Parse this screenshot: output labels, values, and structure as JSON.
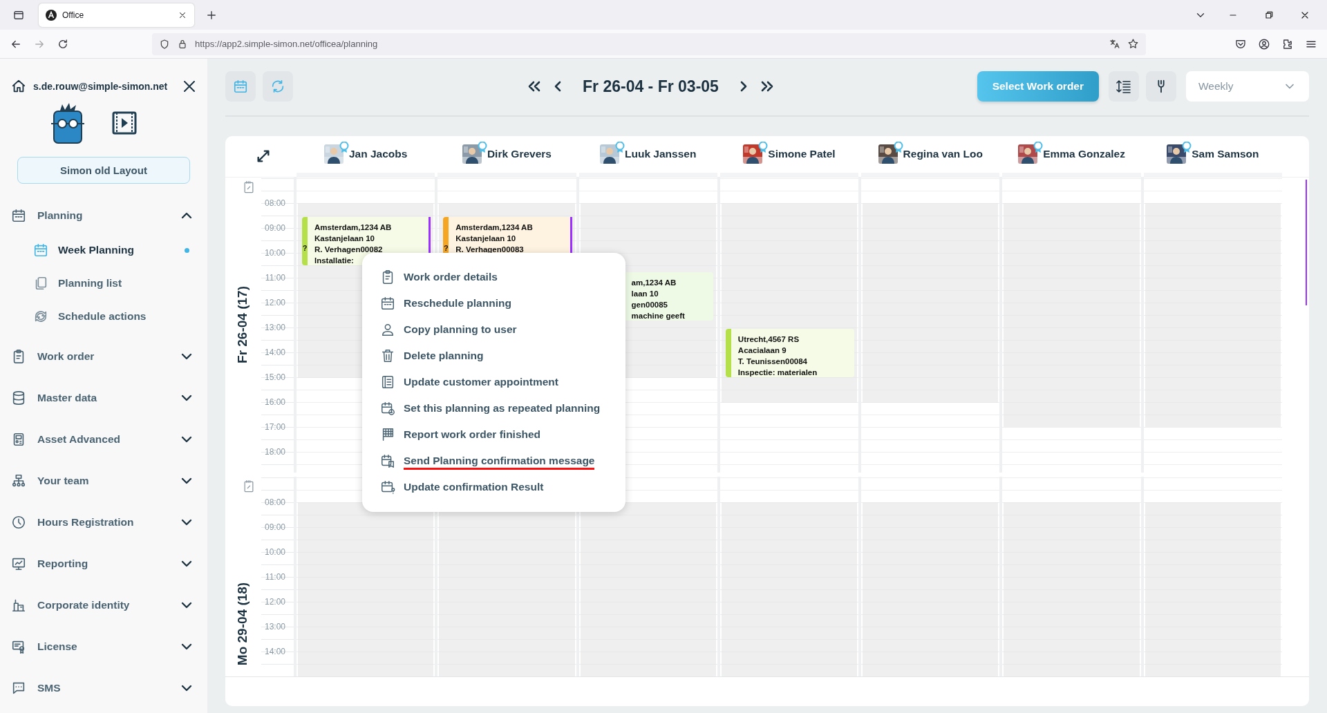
{
  "browser": {
    "tab_title": "Office",
    "url": "https://app2.simple-simon.net/officea/planning"
  },
  "sidebar": {
    "user_email": "s.de.rouw@simple-simon.net",
    "layout_button": "Simon old Layout",
    "items": [
      {
        "label": "Planning",
        "expanded": true,
        "children": [
          {
            "label": "Week Planning",
            "selected": true
          },
          {
            "label": "Planning list",
            "selected": false
          },
          {
            "label": "Schedule actions",
            "selected": false
          }
        ]
      },
      {
        "label": "Work order",
        "expanded": false
      },
      {
        "label": "Master data",
        "expanded": false
      },
      {
        "label": "Asset Advanced",
        "expanded": false
      },
      {
        "label": "Your team",
        "expanded": false
      },
      {
        "label": "Hours Registration",
        "expanded": false
      },
      {
        "label": "Reporting",
        "expanded": false
      },
      {
        "label": "Corporate identity",
        "expanded": false
      },
      {
        "label": "License",
        "expanded": false
      },
      {
        "label": "SMS",
        "expanded": false
      }
    ]
  },
  "toolbar": {
    "date_range": "Fr 26-04 - Fr 03-05",
    "primary_button": "Select Work order",
    "view_select": "Weekly"
  },
  "staff": [
    {
      "name": "Jan Jacobs"
    },
    {
      "name": "Dirk Grevers"
    },
    {
      "name": "Luuk Janssen"
    },
    {
      "name": "Simone Patel"
    },
    {
      "name": "Regina van Loo"
    },
    {
      "name": "Emma Gonzalez"
    },
    {
      "name": "Sam Samson"
    }
  ],
  "days": [
    {
      "label": "Fr 26-04 (17)",
      "hours": [
        "08:00",
        "09:00",
        "10:00",
        "11:00",
        "12:00",
        "13:00",
        "14:00",
        "15:00",
        "16:00",
        "17:00",
        "18:00"
      ],
      "columns": [
        {
          "shading": {
            "level": 0.65
          },
          "events": [
            {
              "kind": "morning",
              "color": "#b5e04a",
              "flagged": true,
              "marker": "?",
              "lines": [
                "Amsterdam,1234 AB",
                "Kastanjelaan 10",
                "R. Verhagen00082",
                "Installatie:"
              ]
            }
          ]
        },
        {
          "shading": {
            "level": 0.65
          },
          "events": [
            {
              "kind": "morning",
              "color": "#f5a623",
              "flagged": true,
              "marker": "?",
              "lines": [
                "Amsterdam,1234 AB",
                "Kastanjelaan 10",
                "R. Verhagen00083"
              ]
            }
          ]
        },
        {
          "shading": {
            "level": 0.65
          },
          "events": [
            {
              "kind": "forenoon",
              "flagged": false,
              "lines": [
                "am,1234 AB",
                "laan 10",
                "gen00085",
                "machine geeft"
              ]
            }
          ]
        },
        {
          "shading": {
            "level": 0.74
          },
          "events": [
            {
              "kind": "afternoon",
              "color": "#b5e04a",
              "flagged": false,
              "lines": [
                "Utrecht,4567 RS",
                "Acacialaan 9",
                "T. Teunissen00084",
                "Inspectie: materialen"
              ]
            }
          ]
        },
        {
          "shading": {
            "level": 0.74
          }
        },
        {
          "shading": {
            "level": 0.83
          }
        },
        {
          "shading": {
            "level": 0.83
          }
        }
      ]
    },
    {
      "label": "Mo 29-04 (18)",
      "hours": [
        "08:00",
        "09:00",
        "10:00",
        "11:00",
        "12:00",
        "13:00",
        "14:00"
      ],
      "columns": [
        {
          "shading": {
            "level": 1
          }
        },
        {
          "shading": {
            "level": 1
          }
        },
        {
          "shading": {
            "level": 1
          }
        },
        {
          "shading": {
            "level": 1
          }
        },
        {
          "shading": {
            "level": 1
          }
        },
        {
          "shading": {
            "level": 1
          }
        },
        {
          "shading": {
            "level": 1
          }
        }
      ]
    }
  ],
  "context_menu": {
    "items": [
      {
        "label": "Work order details",
        "underlined": false
      },
      {
        "label": "Reschedule planning",
        "underlined": false
      },
      {
        "label": "Copy planning to user",
        "underlined": false
      },
      {
        "label": "Delete planning",
        "underlined": false
      },
      {
        "label": "Update customer appointment",
        "underlined": false
      },
      {
        "label": "Set this planning as repeated planning",
        "underlined": false
      },
      {
        "label": "Report work order finished",
        "underlined": false
      },
      {
        "label": "Send Planning confirmation message",
        "underlined": true
      },
      {
        "label": "Update confirmation Result",
        "underlined": false
      }
    ]
  }
}
